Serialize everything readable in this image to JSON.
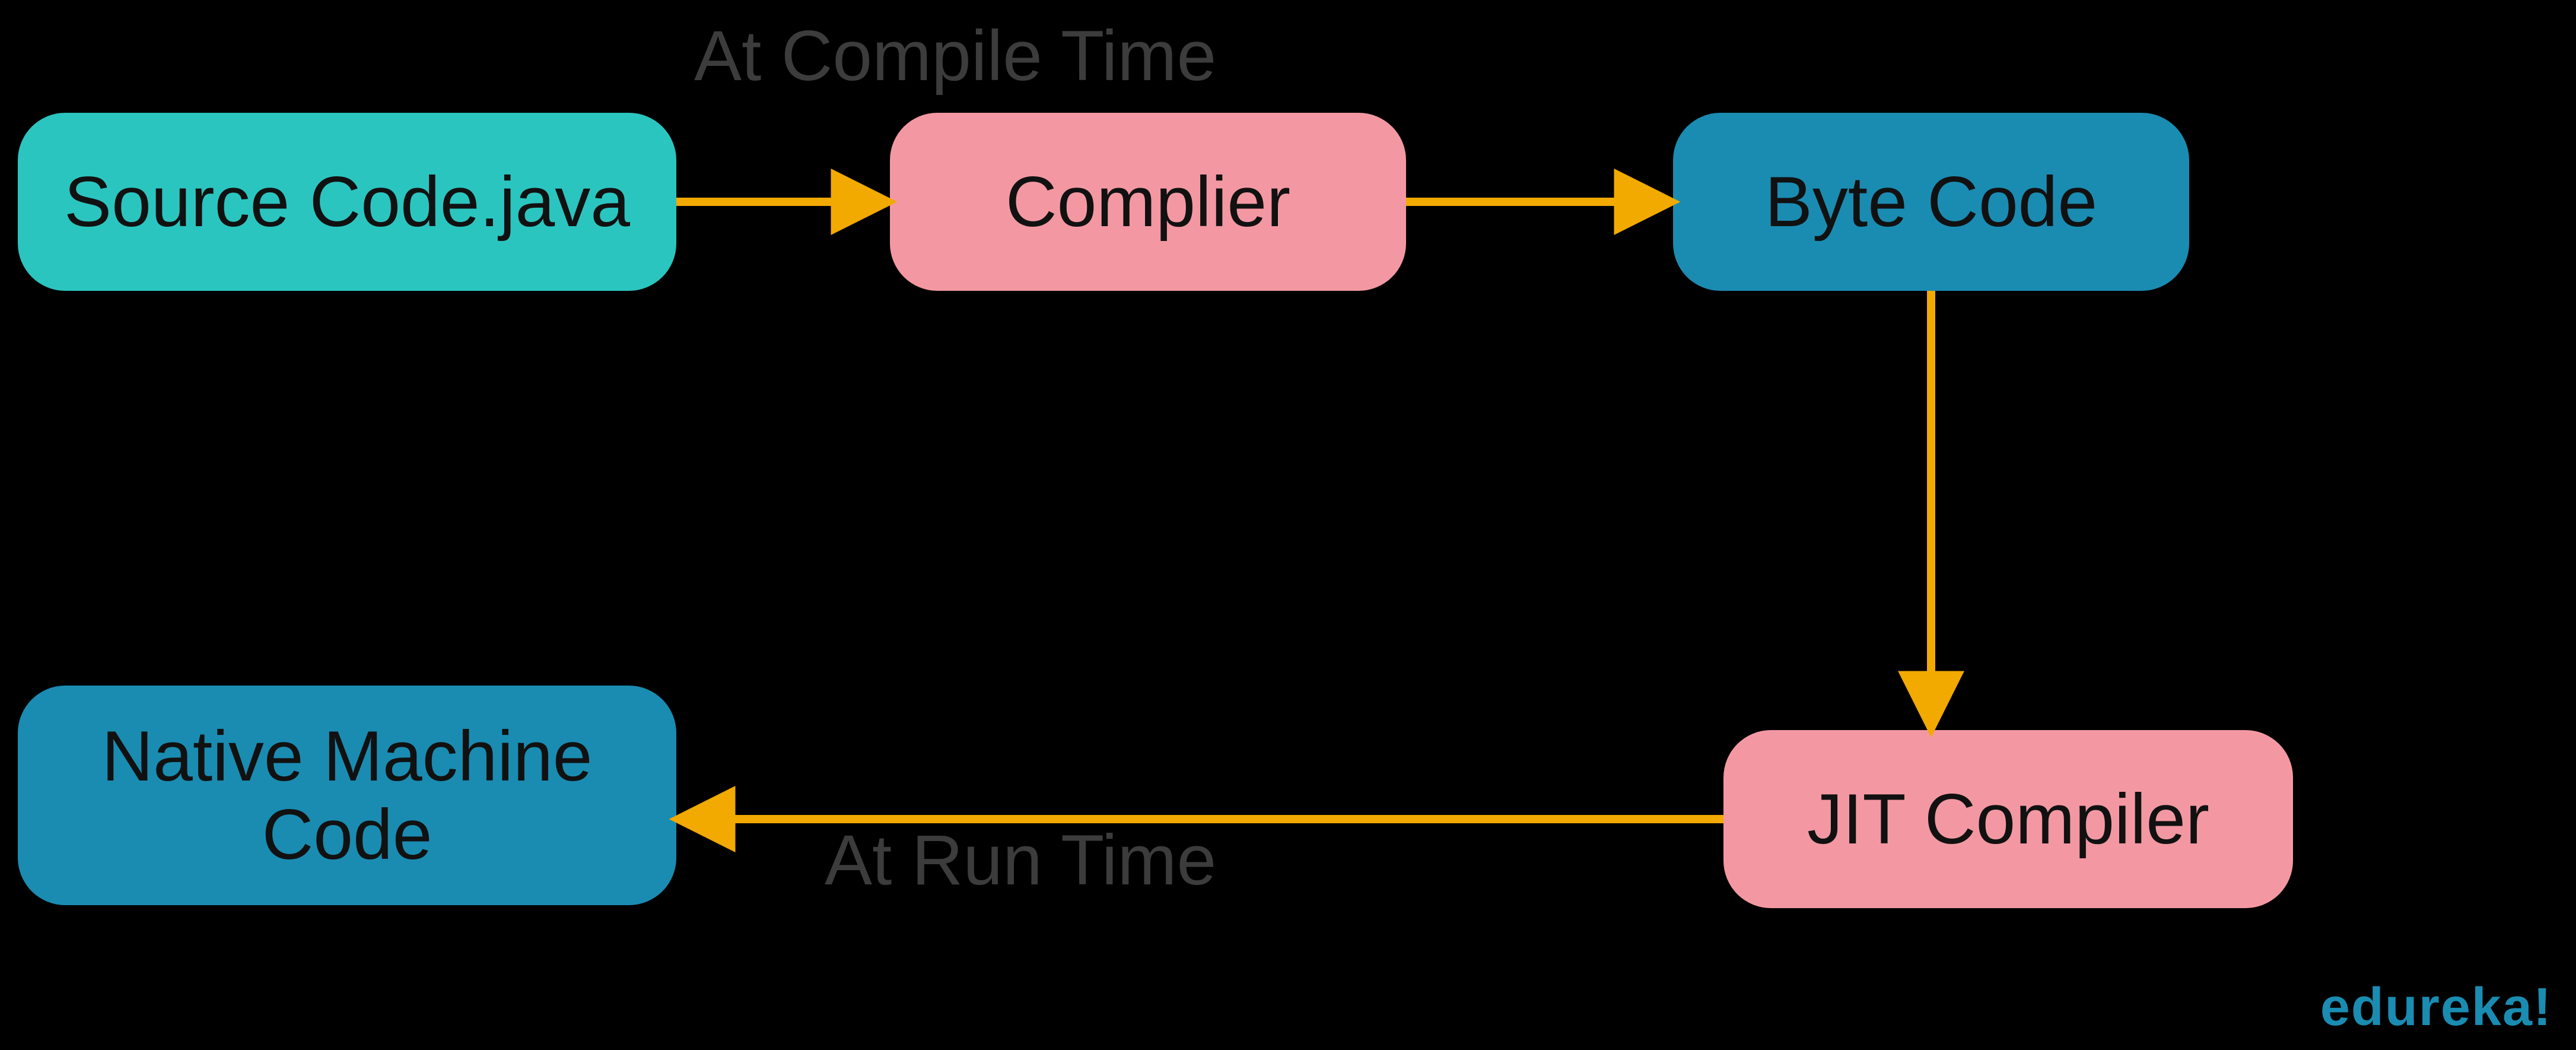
{
  "captions": {
    "compile": "At Compile Time",
    "run": "At Run Time"
  },
  "nodes": {
    "source": "Source Code.java",
    "compiler": "Complier",
    "bytecode": "Byte Code",
    "jit": "JIT Compiler",
    "native": "Native Machine Code"
  },
  "logo": "edureka!",
  "colors": {
    "background": "#000000",
    "teal": "#2bc5c0",
    "pink": "#f398a2",
    "steel": "#1a8cb2",
    "arrow": "#f2a900",
    "caption": "#3c3c3c"
  },
  "flow": [
    {
      "from": "source",
      "to": "compiler",
      "phase": "compile"
    },
    {
      "from": "compiler",
      "to": "bytecode",
      "phase": "compile"
    },
    {
      "from": "bytecode",
      "to": "jit",
      "phase": "run"
    },
    {
      "from": "jit",
      "to": "native",
      "phase": "run"
    }
  ]
}
